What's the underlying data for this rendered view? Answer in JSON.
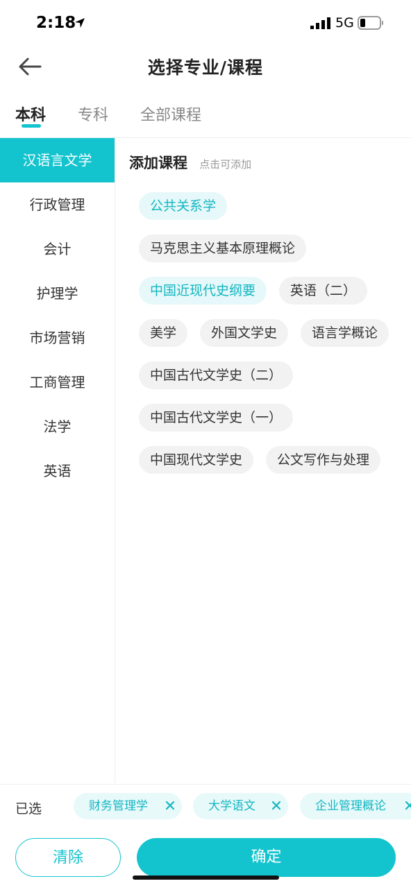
{
  "status": {
    "time": "2:18",
    "network": "5G"
  },
  "nav": {
    "title": "选择专业/课程",
    "back_icon": "arrow-left-icon"
  },
  "tabs": [
    {
      "label": "本科",
      "active": true
    },
    {
      "label": "专科",
      "active": false
    },
    {
      "label": "全部课程",
      "active": false
    }
  ],
  "sidebar": {
    "items": [
      {
        "label": "汉语言文学",
        "active": true
      },
      {
        "label": "行政管理"
      },
      {
        "label": "会计"
      },
      {
        "label": "护理学"
      },
      {
        "label": "市场营销"
      },
      {
        "label": "工商管理"
      },
      {
        "label": "法学"
      },
      {
        "label": "英语"
      }
    ]
  },
  "main": {
    "title": "添加课程",
    "hint": "点击可添加",
    "rows": [
      [
        {
          "label": "公共关系学",
          "selected": true
        }
      ],
      [
        {
          "label": "马克思主义基本原理概论"
        }
      ],
      [
        {
          "label": "中国近现代史纲要",
          "selected": true
        },
        {
          "label": "英语（二）"
        }
      ],
      [
        {
          "label": "美学"
        },
        {
          "label": "外国文学史"
        },
        {
          "label": "语言学概论"
        }
      ],
      [
        {
          "label": "中国古代文学史（二）"
        }
      ],
      [
        {
          "label": "中国古代文学史（一）"
        }
      ],
      [
        {
          "label": "中国现代文学史"
        },
        {
          "label": "公文写作与处理"
        }
      ]
    ]
  },
  "selected_bar": {
    "label": "已选",
    "items": [
      "财务管理学",
      "大学语文",
      "企业管理概论"
    ]
  },
  "buttons": {
    "clear": "清除",
    "confirm": "确定"
  },
  "colors": {
    "accent": "#13c4cf",
    "chip_selected_bg": "#e6f8f9",
    "chip_bg": "#f2f2f2"
  }
}
